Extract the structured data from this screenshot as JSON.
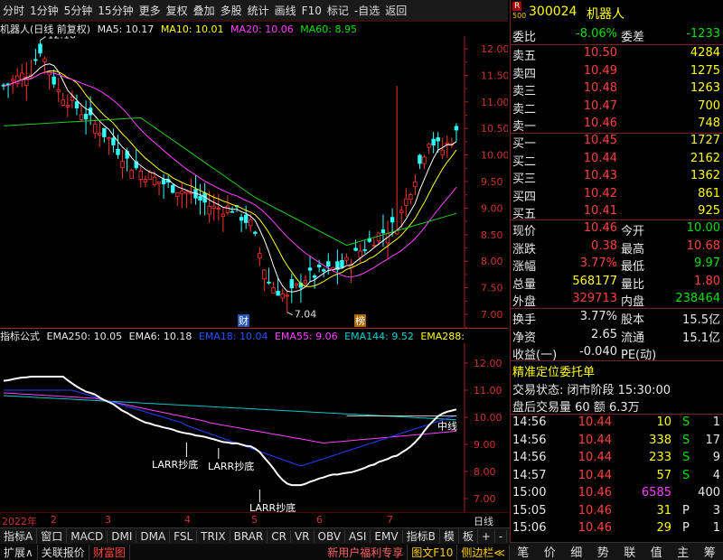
{
  "toolbar": {
    "items": [
      "分时",
      "1分钟",
      "5分钟",
      "15分钟",
      "更多",
      "复权",
      "叠加",
      "多股",
      "统计",
      "画线",
      "F10",
      "标记",
      "-自选",
      "返回"
    ]
  },
  "chart_header": {
    "title": "机器人(日线 前复权)",
    "ma5": "MA5: 10.17",
    "ma10": "MA10: 10.01",
    "ma20": "MA20: 10.06",
    "ma60": "MA60: 8.95"
  },
  "indicator_header": {
    "name": "指标公式",
    "ema250": "EMA250: 10.05",
    "ema6": "EMA6: 10.18",
    "ema18": "EMA18: 10.04",
    "ema55": "EMA55: 9.06",
    "ema144": "EMA144: 9.52",
    "ema288": "EMA288:"
  },
  "price_axis": [
    "12.00",
    "11.50",
    "11.00",
    "10.50",
    "10.00",
    "9.50",
    "9.00",
    "8.50",
    "8.00",
    "7.50",
    "7.00"
  ],
  "ind_axis": [
    "12.00",
    "11.00",
    "10.00",
    "9.00",
    "8.00",
    "7.00"
  ],
  "markers": {
    "high": "12.16",
    "low": "7.04",
    "cai": "财",
    "bang": "榜"
  },
  "ind_labels": {
    "zhongxian": "中线",
    "larr1": "LARR抄底",
    "larr2": "LARR抄底",
    "larr3": "LARR抄底"
  },
  "dates": {
    "year": "2022年",
    "m2": "2",
    "m3": "3",
    "m4": "4",
    "m5": "5",
    "m6": "6",
    "m7": "7",
    "period": "日线"
  },
  "tabs1": [
    "指标A",
    "窗口",
    "MACD",
    "DMI",
    "DMA",
    "FSL",
    "TRIX",
    "BRAR",
    "CR",
    "VR",
    "OBV",
    "ASI",
    "EMV",
    "指标B",
    "模",
    "板",
    "+",
    "-"
  ],
  "tabs2": [
    "扩展∧",
    "关联报价",
    "财富图",
    "新用户福利专享",
    "图文F10",
    "侧边栏≪"
  ],
  "quote": {
    "code": "300024",
    "name": "机器人",
    "badge_r": "R",
    "badge_n": "500",
    "weibi_l": "委比",
    "weibi_v": "-8.06%",
    "weicha_l": "委差",
    "weicha_v": "-1233",
    "sell": [
      {
        "l": "卖五",
        "p": "10.50",
        "v": "4284"
      },
      {
        "l": "卖四",
        "p": "10.49",
        "v": "1275"
      },
      {
        "l": "卖三",
        "p": "10.48",
        "v": "1263"
      },
      {
        "l": "卖二",
        "p": "10.47",
        "v": "700"
      },
      {
        "l": "卖一",
        "p": "10.46",
        "v": "748"
      }
    ],
    "buy": [
      {
        "l": "买一",
        "p": "10.45",
        "v": "1727"
      },
      {
        "l": "买二",
        "p": "10.44",
        "v": "2162"
      },
      {
        "l": "买三",
        "p": "10.43",
        "v": "1362"
      },
      {
        "l": "买四",
        "p": "10.42",
        "v": "861"
      },
      {
        "l": "买五",
        "p": "10.41",
        "v": "925"
      }
    ],
    "stats": [
      {
        "a": "现价",
        "b": "10.46",
        "c": "今开",
        "d": "10.00",
        "bc": "red",
        "dc": "grn"
      },
      {
        "a": "涨跌",
        "b": "0.38",
        "c": "最高",
        "d": "10.68",
        "bc": "red",
        "dc": "red"
      },
      {
        "a": "涨幅",
        "b": "3.77%",
        "c": "最低",
        "d": "9.97",
        "bc": "red",
        "dc": "grn"
      },
      {
        "a": "总量",
        "b": "568177",
        "c": "量比",
        "d": "1.80",
        "bc": "yel",
        "dc": "red"
      },
      {
        "a": "外盘",
        "b": "329713",
        "c": "内盘",
        "d": "238464",
        "bc": "red",
        "dc": "grn"
      }
    ],
    "stats2": [
      {
        "a": "换手",
        "b": "3.77%",
        "c": "股本",
        "d": "15.5亿"
      },
      {
        "a": "净资",
        "b": "2.65",
        "c": "流通",
        "d": "15.1亿"
      },
      {
        "a": "收益(一)",
        "b": "-0.040",
        "c": "PE(动)",
        "d": ""
      }
    ],
    "entrust_title": "精准定位委托单",
    "trade_state": "交易状态: 闭市阶段 15:30:00",
    "after_hours": "盘后交易量 60 额 6.3万",
    "ticks": [
      {
        "t": "14:56",
        "p": "10.44",
        "v": "10",
        "s": "S",
        "n": "1",
        "vc": "yel"
      },
      {
        "t": "14:56",
        "p": "10.44",
        "v": "338",
        "s": "S",
        "n": "17",
        "vc": "yel"
      },
      {
        "t": "14:56",
        "p": "10.44",
        "v": "233",
        "s": "S",
        "n": "9",
        "vc": "yel"
      },
      {
        "t": "14:57",
        "p": "10.44",
        "v": "57",
        "s": "S",
        "n": "4",
        "vc": "yel"
      },
      {
        "t": "15:00",
        "p": "10.46",
        "v": "6585",
        "s": "",
        "n": "400",
        "vc": "mag"
      },
      {
        "t": "15:05",
        "p": "10.46",
        "v": "31",
        "s": "P",
        "n": "3",
        "vc": "yel"
      },
      {
        "t": "15:06",
        "p": "10.46",
        "v": "29",
        "s": "P",
        "n": "1",
        "vc": "yel"
      }
    ],
    "bottom_tabs": [
      "笔",
      "价",
      "细",
      "势",
      "联",
      "值",
      "主",
      "筹"
    ]
  }
}
